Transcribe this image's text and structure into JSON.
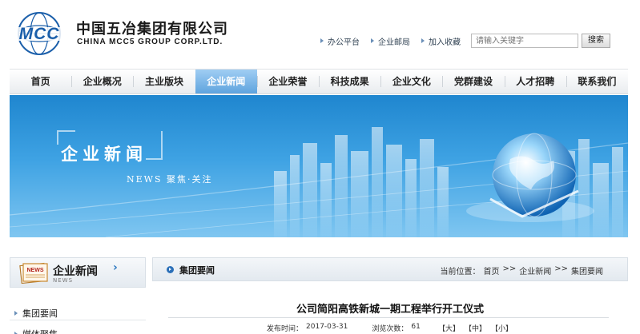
{
  "header": {
    "logo_text": "MCC",
    "company_cn": "中国五冶集团有限公司",
    "company_en": "CHINA MCC5 GROUP CORP.LTD.",
    "top_links": [
      "办公平台",
      "企业邮局",
      "加入收藏"
    ],
    "search_placeholder": "请输入关键字",
    "search_button": "搜索"
  },
  "nav": {
    "items": [
      "首页",
      "企业概况",
      "主业版块",
      "企业新闻",
      "企业荣誉",
      "科技成果",
      "企业文化",
      "党群建设",
      "人才招聘",
      "联系我们"
    ],
    "active_index": 3
  },
  "banner": {
    "title": "企业新闻",
    "subtitle": "NEWS  聚焦·关注"
  },
  "sidebar": {
    "title": "企业新闻",
    "title_en": "NEWS",
    "chevron": "›",
    "icon_label": "NEWS",
    "items": [
      "集团要闻",
      "媒体聚焦"
    ]
  },
  "content": {
    "section_title": "集团要闻",
    "breadcrumb": {
      "prefix": "当前位置：",
      "items": [
        "首页",
        "企业新闻",
        "集团要闻"
      ],
      "separator": ">>"
    },
    "article": {
      "title": "公司简阳高铁新城一期工程举行开工仪式",
      "publish_label": "发布时间：",
      "publish_date": "2017-03-31",
      "views_label": "浏览次数：",
      "views": "61",
      "font_sizes": [
        "【大】",
        "【中】",
        "【小】"
      ]
    }
  },
  "colors": {
    "brand_blue": "#1b5faa",
    "nav_active": "#5fa4de",
    "banner_top": "#1f86cf",
    "banner_bottom": "#7fc6f1"
  }
}
